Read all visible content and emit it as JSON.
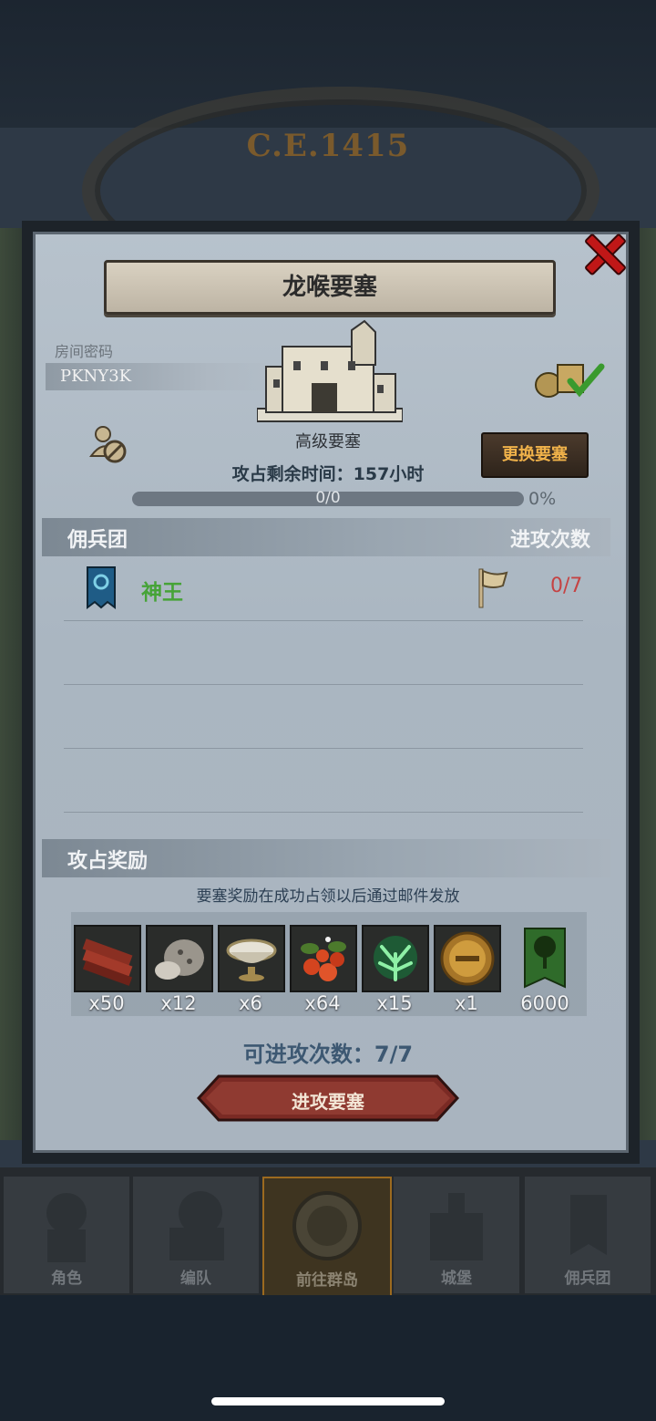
{
  "header": {
    "year": "C.E.1415"
  },
  "dialog": {
    "title": "龙喉要塞",
    "room_code_label": "房间密码",
    "room_code": "PKNY3K",
    "fortress_type": "高级要塞",
    "timer_label": "攻占剩余时间：",
    "timer_value": "157小时",
    "progress_text": "0/0",
    "progress_percent": "0%",
    "progress_fraction": 0,
    "change_button": "更换要塞"
  },
  "mercenary": {
    "header_left": "佣兵团",
    "header_right": "进攻次数",
    "rows": [
      {
        "name": "神王",
        "attacks": "0/7"
      }
    ]
  },
  "rewards": {
    "header": "攻占奖励",
    "note": "要塞奖励在成功占领以后通过邮件发放",
    "items": [
      {
        "icon": "wood-planks-icon",
        "count": "x50"
      },
      {
        "icon": "stone-ore-icon",
        "count": "x12"
      },
      {
        "icon": "silver-bowl-icon",
        "count": "x6"
      },
      {
        "icon": "berries-icon",
        "count": "x64"
      },
      {
        "icon": "green-crystal-icon",
        "count": "x15"
      },
      {
        "icon": "golden-helmet-icon",
        "count": "x1"
      },
      {
        "icon": "green-tree-banner-icon",
        "count": "6000"
      }
    ],
    "remaining_attacks": "可进攻次数：7/7",
    "attack_button": "进攻要塞"
  },
  "nav": {
    "items": [
      {
        "label": "角色",
        "icon": "character-icon"
      },
      {
        "label": "编队",
        "icon": "formation-icon"
      },
      {
        "label": "前往群岛",
        "icon": "compass-icon",
        "active": true
      },
      {
        "label": "城堡",
        "icon": "castle-icon"
      },
      {
        "label": "佣兵团",
        "icon": "mercenary-icon"
      }
    ]
  }
}
